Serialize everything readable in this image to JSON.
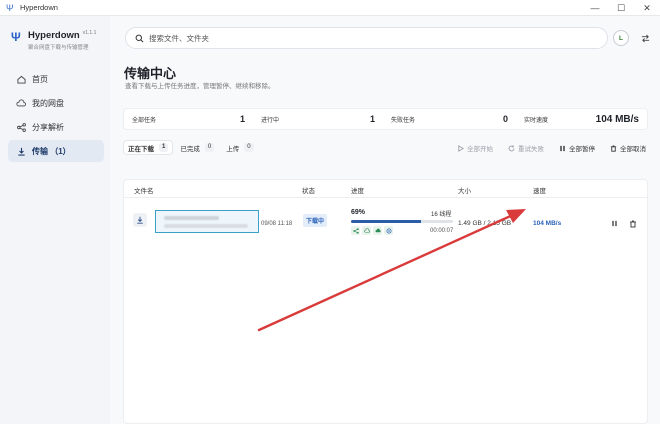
{
  "window": {
    "title": "Hyperdown"
  },
  "brand": {
    "name": "Hyperdown",
    "version": "v1.1.1",
    "subtitle": "聚合网盘下载与传输管理"
  },
  "sidebar": {
    "items": [
      {
        "label": "首页",
        "icon": "home-icon"
      },
      {
        "label": "我的网盘",
        "icon": "cloud-icon"
      },
      {
        "label": "分享解析",
        "icon": "share-icon"
      },
      {
        "label": "传输 （1）",
        "icon": "download-icon",
        "active": true
      }
    ]
  },
  "search": {
    "placeholder": "搜索文件、文件夹"
  },
  "avatar": {
    "initial": "L"
  },
  "page": {
    "title": "传输中心",
    "subtitle": "查看下载与上传任务进度，管理暂停、继续和移除。"
  },
  "stats": [
    {
      "label": "全部任务",
      "value": "1"
    },
    {
      "label": "进行中",
      "value": "1"
    },
    {
      "label": "失败任务",
      "value": "0"
    },
    {
      "label": "实时速度",
      "value": "104 MB/s"
    }
  ],
  "tabs": [
    {
      "label": "正在下载",
      "count": "1",
      "active": true
    },
    {
      "label": "已完成",
      "count": "0"
    },
    {
      "label": "上传",
      "count": "0"
    }
  ],
  "actions": [
    {
      "label": "全部开始",
      "disabled": true
    },
    {
      "label": "重试失败",
      "disabled": true
    },
    {
      "label": "全部暂停"
    },
    {
      "label": "全部取消"
    }
  ],
  "table": {
    "headers": {
      "name": "文件名",
      "status": "状态",
      "progress": "进度",
      "size": "大小",
      "speed": "速度"
    },
    "rows": [
      {
        "time": "09/08 11:18",
        "status": "下载中",
        "percent": "69%",
        "progress_fraction": 0.69,
        "threads": "16 线程",
        "eta": "00:00:07",
        "size": "1.49 GB / 2.15 GB",
        "speed": "104 MB/s"
      }
    ]
  },
  "colors": {
    "accent": "#2b5ca6",
    "annotation_arrow": "#d93a3a",
    "selection": "#3aa0c8"
  }
}
